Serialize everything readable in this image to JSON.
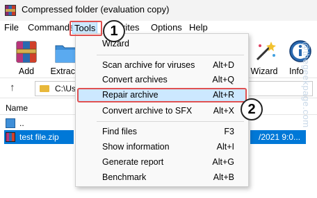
{
  "window": {
    "title": "Compressed folder (evaluation copy)"
  },
  "menubar": {
    "items": [
      "File",
      "Commands",
      "Tools",
      "rites",
      "Options",
      "Help"
    ]
  },
  "toolbar": {
    "add_label": "Add",
    "extract_label": "Extract",
    "wizard_label": "Wizard",
    "info_label": "Info"
  },
  "address": {
    "path": "C:\\Us"
  },
  "filelist": {
    "column_name": "Name",
    "up_row": "..",
    "file_name": "test file.zip",
    "file_date": "/2021 9:0..."
  },
  "tools_menu": {
    "wizard": "Wizard",
    "scan": {
      "label": "Scan archive for viruses",
      "shortcut": "Alt+D"
    },
    "convert": {
      "label": "Convert archives",
      "shortcut": "Alt+Q"
    },
    "repair": {
      "label": "Repair archive",
      "shortcut": "Alt+R"
    },
    "sfx": {
      "label": "Convert archive to SFX",
      "shortcut": "Alt+X"
    },
    "find": {
      "label": "Find files",
      "shortcut": "F3"
    },
    "info": {
      "label": "Show information",
      "shortcut": "Alt+I"
    },
    "report": {
      "label": "Generate report",
      "shortcut": "Alt+G"
    },
    "bench": {
      "label": "Benchmark",
      "shortcut": "Alt+B"
    }
  },
  "annotations": {
    "step1": "1",
    "step2": "2"
  },
  "watermark": "@thegeekpage.com",
  "colors": {
    "accent": "#0078d7",
    "highlight": "#cce8ff",
    "annotation_red": "#e05050"
  }
}
